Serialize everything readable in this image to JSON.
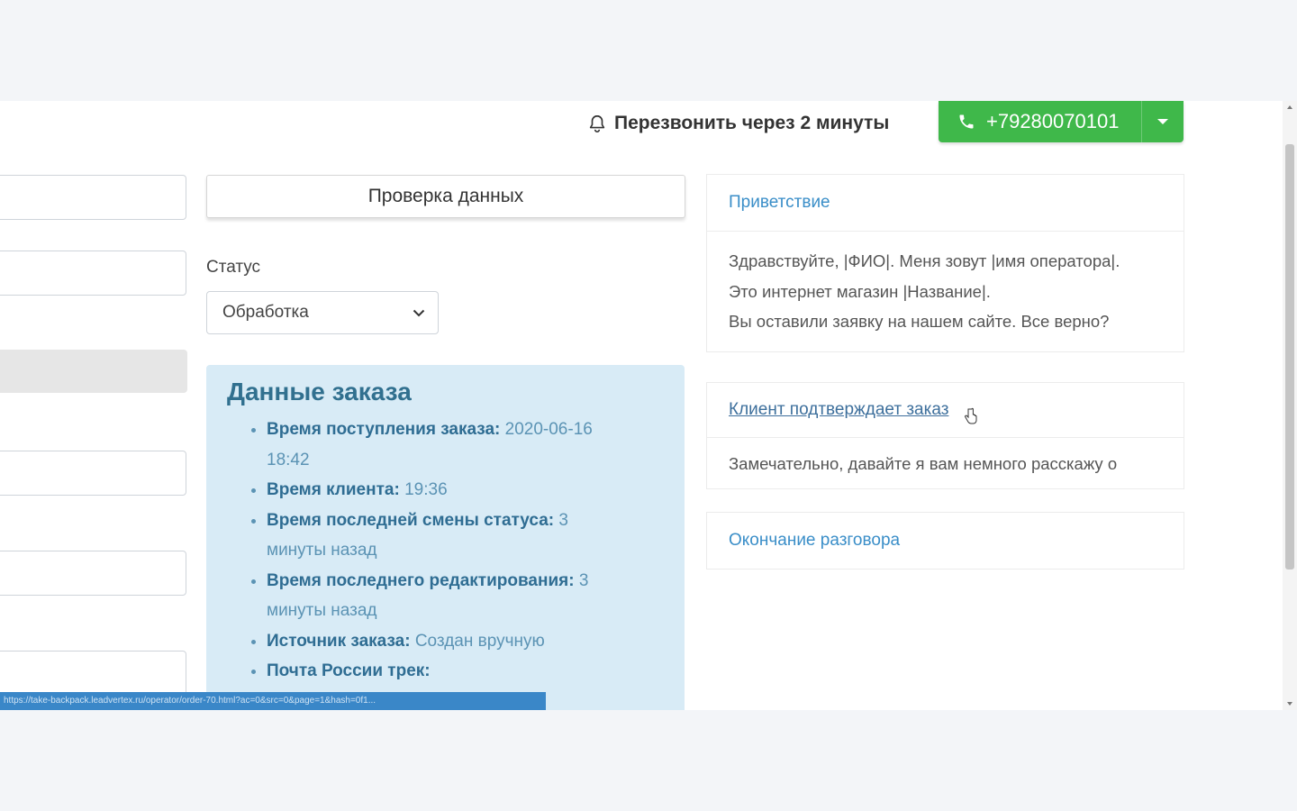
{
  "topbar": {
    "callback_label": "Перезвонить через 2 минуты",
    "phone_number": "+79280070101"
  },
  "check_button_label": "Проверка данных",
  "status": {
    "label": "Статус",
    "selected": "Обработка"
  },
  "order": {
    "title": "Данные заказа",
    "items": [
      {
        "label": "Время поступления заказа:",
        "value": "2020-06-16 18:42"
      },
      {
        "label": "Время клиента:",
        "value": "19:36"
      },
      {
        "label": "Время последней смены статуса:",
        "value": "3 минуты назад"
      },
      {
        "label": "Время последнего редактирования:",
        "value": "3 минуты назад"
      },
      {
        "label": "Источник заказа:",
        "value": "Создан вручную"
      },
      {
        "label": "Почта России трек:",
        "value": ""
      }
    ]
  },
  "statusbar_url": "https://take-backpack.leadvertex.ru/operator/order-70.html?ac=0&src=0&page=1&hash=0f1...",
  "script": {
    "greeting_title": "Приветствие",
    "greeting_lines": [
      "Здравствуйте, |ФИО|. Меня зовут |имя оператора|.",
      "Это интернет  магазин |Название|.",
      "Вы оставили заявку на нашем сайте. Все верно?"
    ],
    "confirm_title": "Клиент подтверждает заказ",
    "confirm_text": "Замечательно, давайте я вам немного расскажу о",
    "ending_title": "Окончание разговора"
  }
}
